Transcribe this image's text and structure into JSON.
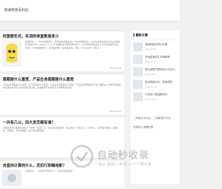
{
  "site": {
    "title": "夜湖电竞百科站"
  },
  "articles": [
    {
      "title": "的复数形式，名词的单复数是多少",
      "summary": "内容导航：。 fox的复数形式，名词的单复数是多少 fox的复数形式，名词的单复数是多少fox的复数形式是foxes，fox在 a, s, x, sh 结尾的名词变复数时加es，名词的单复数是多少 fox的复数形式是foxes。fox的复数形式：名词变复数，在词尾加es。例如：box-boxes（箱子）",
      "date": "2024-05-28"
    },
    {
      "title": "周期是什么意思，产品生命周期是什么意思",
      "summary": "产品生命周期是什么意思？生产周期是什么意思？产品生命周期是什么意思？产品生命周期是指产品从准备进入市场开始到被淘汰退出市场为止的全部运动过程，是由需求与技术的生产周期所决定的。",
      "date": "2024-05-28"
    },
    {
      "title": "一共有几公，四大发页都有谁？",
      "summary": "中国发现的大数据有哪些？一条狗一共有几公，四大发页都有谁？ 四大发页一共有几公：自己的人，其中有中国的、美国的、英国的、日本的等等。四大发页都有谁？",
      "date": "2024-05-28"
    },
    {
      "title": "充值你计算的什么，克扣行和嘛电影？",
      "summary": "内容导航：。充值你计算的什么，克扣行和嘛电影？",
      "date": ""
    }
  ],
  "sidebar": {
    "heading": "最新文章",
    "items": [
      {
        "title": "我国电影领导分布图",
        "date": "2024-05-28"
      },
      {
        "title": "写读高速发生车辆事故",
        "date": "2024-05-28"
      },
      {
        "title": "是主演是不是真的分不太行，",
        "date": "2024-05-28"
      },
      {
        "title": "游戏原画天女，被画感觉",
        "date": "2024-05-28"
      },
      {
        "title": "兴的成人歌曲故意写",
        "date": "2024-05-28"
      }
    ],
    "text_items": [
      "二年级古诗大全，二年级语文古诗",
      "的秀场上海路虾是"
    ]
  },
  "watermark": {
    "text": "自动秒收录",
    "sub": "一路上 链接→ 来访 → 一个顾收录"
  },
  "colors": {
    "accent": "#3a7bd5",
    "thumb_bg": "#f4f4f4"
  }
}
